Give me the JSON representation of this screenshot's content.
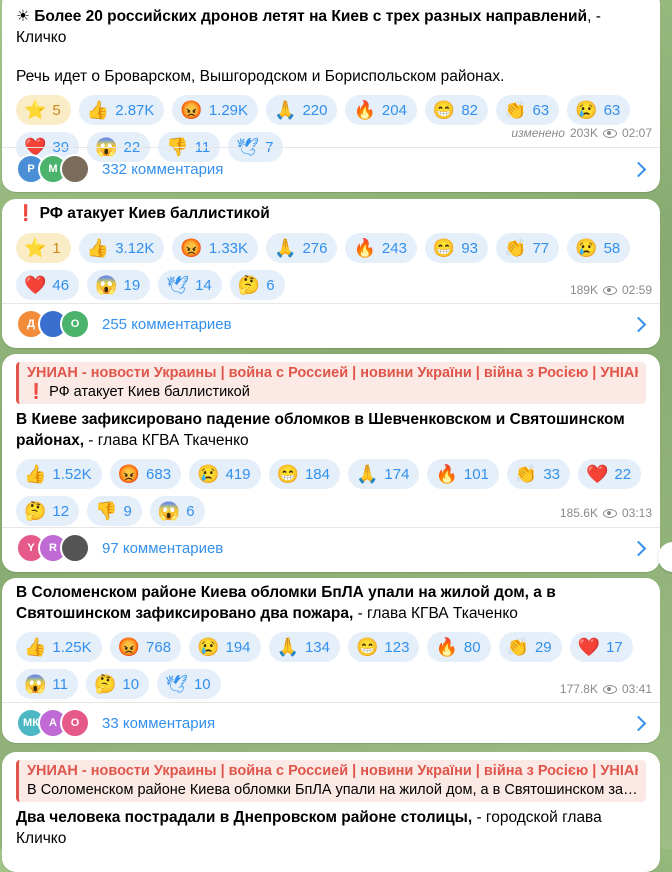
{
  "posts": [
    {
      "title_emoji": "☀",
      "title": "Более 20 российских дронов летят на Киев с трех разных направлений",
      "title_suffix": ", - Кличко",
      "body": "Речь идет о Броварском, Вышгородском и Бориспольском районах.",
      "paid": {
        "emoji": "⭐",
        "count": "5"
      },
      "reactions": [
        {
          "emoji": "👍",
          "count": "2.87K"
        },
        {
          "emoji": "😡",
          "count": "1.29K"
        },
        {
          "emoji": "🙏",
          "count": "220"
        },
        {
          "emoji": "🔥",
          "count": "204"
        },
        {
          "emoji": "😁",
          "count": "82"
        },
        {
          "emoji": "👏",
          "count": "63"
        },
        {
          "emoji": "😢",
          "count": "63"
        },
        {
          "emoji": "❤️",
          "count": "39"
        },
        {
          "emoji": "😱",
          "count": "22"
        },
        {
          "emoji": "👎",
          "count": "11"
        },
        {
          "emoji": "🕊",
          "count": "7"
        }
      ],
      "edited": "изменено",
      "views": "203K",
      "time": "02:07",
      "comments_label": "332 комментария",
      "avatars": [
        {
          "t": "Р",
          "c": "#4a8fd6"
        },
        {
          "t": "М",
          "c": "#4bb36b"
        },
        {
          "t": "",
          "c": "#7b6b5a"
        }
      ]
    },
    {
      "title_emoji": "❗",
      "title": "РФ атакует Киев баллистикой",
      "paid": {
        "emoji": "⭐",
        "count": "1"
      },
      "reactions": [
        {
          "emoji": "👍",
          "count": "3.12K"
        },
        {
          "emoji": "😡",
          "count": "1.33K"
        },
        {
          "emoji": "🙏",
          "count": "276"
        },
        {
          "emoji": "🔥",
          "count": "243"
        },
        {
          "emoji": "😁",
          "count": "93"
        },
        {
          "emoji": "👏",
          "count": "77"
        },
        {
          "emoji": "😢",
          "count": "58"
        },
        {
          "emoji": "❤️",
          "count": "46"
        },
        {
          "emoji": "😱",
          "count": "19"
        },
        {
          "emoji": "🕊",
          "count": "14"
        },
        {
          "emoji": "🤔",
          "count": "6"
        }
      ],
      "views": "189K",
      "time": "02:59",
      "comments_label": "255 комментариев",
      "avatars": [
        {
          "t": "Д",
          "c": "#f28b3a"
        },
        {
          "t": "",
          "c": "#3a6fd0"
        },
        {
          "t": "О",
          "c": "#4bb36b"
        }
      ]
    },
    {
      "reply_title": "УНИАН - новости Украины | война с Россией | новини України | війна з Росією | УНІАН",
      "reply_emoji": "❗",
      "reply_text": "РФ атакует Киев баллистикой",
      "title": "В Киеве зафиксировано падение обломков в Шевченковском и Святошинском районах,",
      "title_suffix": " - глава КГВА Ткаченко",
      "reactions": [
        {
          "emoji": "👍",
          "count": "1.52K"
        },
        {
          "emoji": "😡",
          "count": "683"
        },
        {
          "emoji": "😢",
          "count": "419"
        },
        {
          "emoji": "😁",
          "count": "184"
        },
        {
          "emoji": "🙏",
          "count": "174"
        },
        {
          "emoji": "🔥",
          "count": "101"
        },
        {
          "emoji": "👏",
          "count": "33"
        },
        {
          "emoji": "❤️",
          "count": "22"
        },
        {
          "emoji": "🤔",
          "count": "12"
        },
        {
          "emoji": "👎",
          "count": "9"
        },
        {
          "emoji": "😱",
          "count": "6"
        }
      ],
      "views": "185.6K",
      "time": "03:13",
      "comments_label": "97 комментариев",
      "avatars": [
        {
          "t": "Y",
          "c": "#e55a8a"
        },
        {
          "t": "R",
          "c": "#c06ad6"
        },
        {
          "t": "",
          "c": "#555"
        }
      ]
    },
    {
      "title": "В Соломенском районе Киева обломки БпЛА упали на жилой дом, а в Святошинском зафиксировано два пожара,",
      "title_suffix": " - глава КГВА Ткаченко",
      "reactions": [
        {
          "emoji": "👍",
          "count": "1.25K"
        },
        {
          "emoji": "😡",
          "count": "768"
        },
        {
          "emoji": "😢",
          "count": "194"
        },
        {
          "emoji": "🙏",
          "count": "134"
        },
        {
          "emoji": "😁",
          "count": "123"
        },
        {
          "emoji": "🔥",
          "count": "80"
        },
        {
          "emoji": "👏",
          "count": "29"
        },
        {
          "emoji": "❤️",
          "count": "17"
        },
        {
          "emoji": "😱",
          "count": "11"
        },
        {
          "emoji": "🤔",
          "count": "10"
        },
        {
          "emoji": "🕊",
          "count": "10"
        }
      ],
      "views": "177.8K",
      "time": "03:41",
      "comments_label": "33 комментария",
      "avatars": [
        {
          "t": "МК",
          "c": "#4bb8c4"
        },
        {
          "t": "А",
          "c": "#c06ad6"
        },
        {
          "t": "О",
          "c": "#e55a8a"
        }
      ]
    },
    {
      "reply_title": "УНИАН - новости Украины | война с Россией | новини України | війна з Росією | УНІАН",
      "reply_text": "В Соломенском районе Киева обломки БпЛА упали на жилой дом, а в Святошинском зафикс...",
      "title": "Два человека пострадали в Днепровском районе столицы,",
      "title_suffix": " - городской глава Кличко"
    }
  ]
}
